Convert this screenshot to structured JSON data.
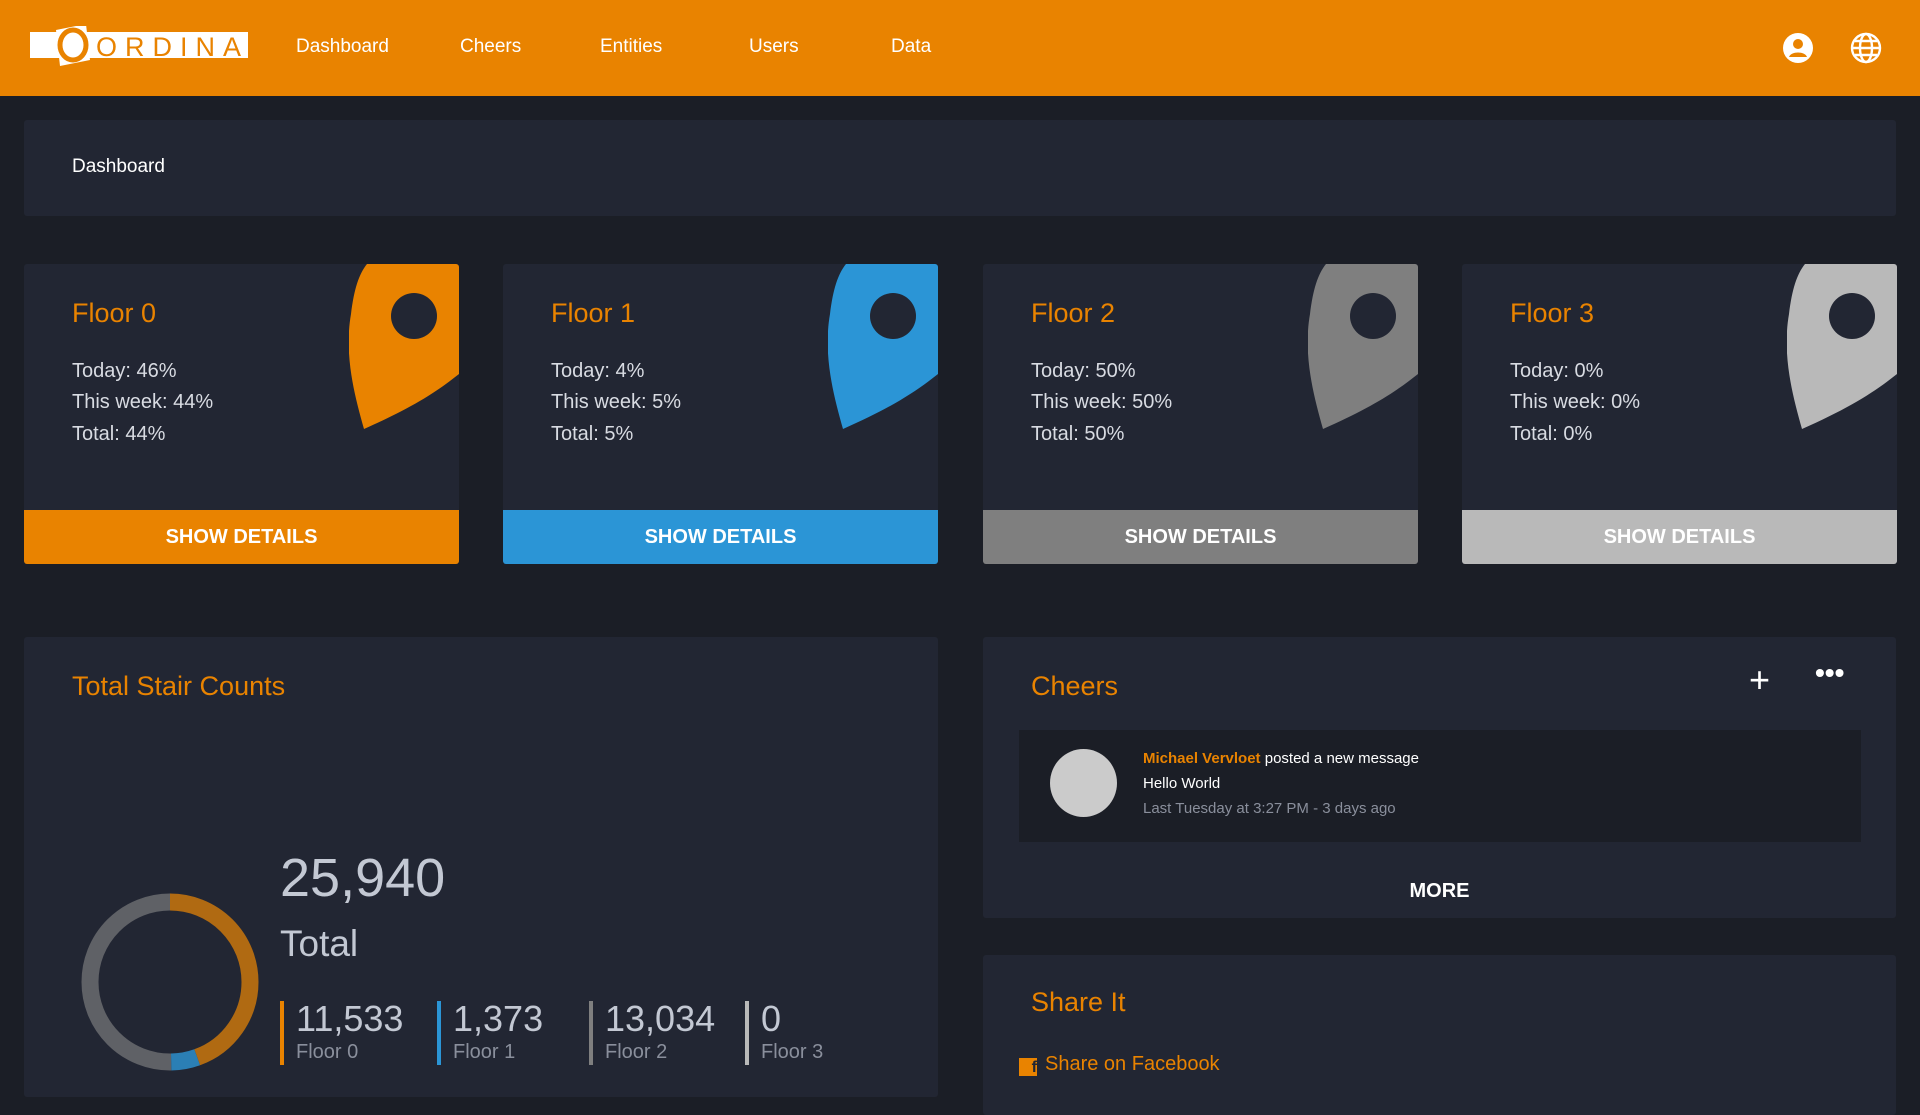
{
  "header": {
    "logo": "ORDINA",
    "nav": [
      "Dashboard",
      "Cheers",
      "Entities",
      "Users",
      "Data"
    ]
  },
  "breadcrumb": "Dashboard",
  "floors": [
    {
      "title": "Floor 0",
      "today": "Today: 46%",
      "week": "This week: 44%",
      "total": "Total: 44%",
      "button": "SHOW DETAILS",
      "color": "#e98300"
    },
    {
      "title": "Floor 1",
      "today": "Today: 4%",
      "week": "This week: 5%",
      "total": "Total: 5%",
      "button": "SHOW DETAILS",
      "color": "#2b95d6"
    },
    {
      "title": "Floor 2",
      "today": "Today: 50%",
      "week": "This week: 50%",
      "total": "Total: 50%",
      "button": "SHOW DETAILS",
      "color": "#7f7f7f"
    },
    {
      "title": "Floor 3",
      "today": "Today: 0%",
      "week": "This week: 0%",
      "total": "Total: 0%",
      "button": "SHOW DETAILS",
      "color": "#b9b9b9"
    }
  ],
  "stairs": {
    "title": "Total Stair Counts",
    "total": "25,940",
    "total_label": "Total",
    "items": [
      {
        "value": "11,533",
        "label": "Floor 0",
        "num": 11533
      },
      {
        "value": "1,373",
        "label": "Floor 1",
        "num": 1373
      },
      {
        "value": "13,034",
        "label": "Floor 2",
        "num": 13034
      },
      {
        "value": "0",
        "label": "Floor 3",
        "num": 0
      }
    ]
  },
  "cheers": {
    "title": "Cheers",
    "author": "Michael Vervloet",
    "action": " posted a new message",
    "message": "Hello World",
    "time": "Last Tuesday at 3:27 PM - 3 days ago",
    "more": "MORE"
  },
  "share": {
    "title": "Share It",
    "facebook": "Share on Facebook"
  }
}
